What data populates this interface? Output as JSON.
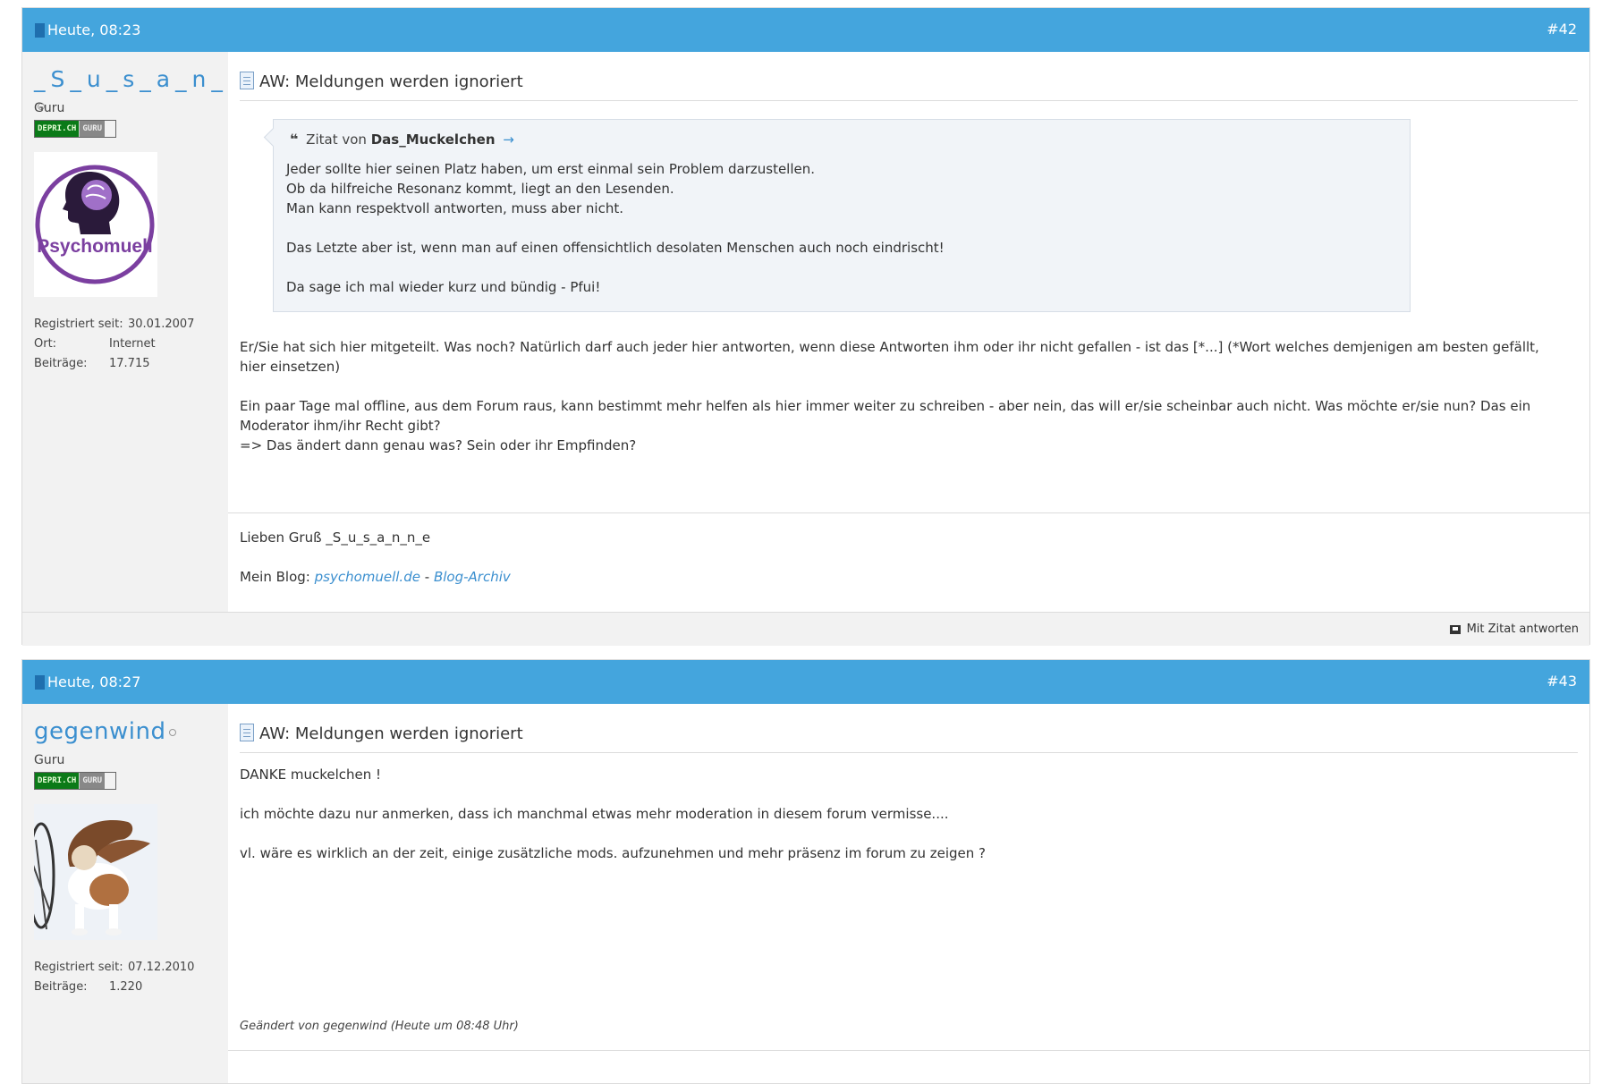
{
  "posts": [
    {
      "date": "Heute, 08:23",
      "number": "#42",
      "username": "_S_u_s_a_n_n_e_",
      "user_title": "Guru",
      "rank_badge": [
        "DEPRI.CH",
        "GURU"
      ],
      "avatar_text": "Psychomuell",
      "stats": [
        {
          "label": "Registriert seit:",
          "value": "30.01.2007"
        },
        {
          "label": "Ort:",
          "value": "Internet"
        },
        {
          "label": "Beiträge:",
          "value": "17.715"
        }
      ],
      "title": "AW: Meldungen werden ignoriert",
      "quote": {
        "prefix": "Zitat von",
        "author": "Das_Muckelchen",
        "lines": [
          "Jeder sollte hier seinen Platz haben, um erst einmal sein Problem darzustellen.",
          "Ob da hilfreiche Resonanz kommt, liegt an den Lesenden.",
          "Man kann respektvoll antworten, muss aber nicht.",
          "",
          "Das Letzte aber ist, wenn man auf einen offensichtlich desolaten Menschen auch noch eindrischt!",
          "",
          "Da sage ich mal wieder kurz und bündig - Pfui!"
        ]
      },
      "message": [
        "Er/Sie hat sich hier mitgeteilt. Was noch? Natürlich darf auch jeder hier antworten, wenn diese Antworten ihm oder ihr nicht gefallen - ist das [*...] (*Wort welches demjenigen am besten gefällt, hier einsetzen)",
        "",
        "Ein paar Tage mal offline, aus dem Forum raus, kann bestimmt mehr helfen als hier immer weiter zu schreiben - aber nein, das will er/sie scheinbar auch nicht. Was möchte er/sie nun? Das ein Moderator ihm/ihr Recht gibt?",
        "=> Das ändert dann genau was? Sein oder ihr Empfinden?"
      ],
      "signature": {
        "greeting": "Lieben Gruß _S_u_s_a_n_n_e",
        "blog_label": "Mein Blog:",
        "blog_link": "psychomuell.de",
        "separator": "-",
        "archive_link": "Blog-Archiv"
      },
      "reply_quote_label": "Mit Zitat antworten"
    },
    {
      "date": "Heute, 08:27",
      "number": "#43",
      "username": "gegenwind",
      "user_title": "Guru",
      "rank_badge": [
        "DEPRI.CH",
        "GURU"
      ],
      "stats": [
        {
          "label": "Registriert seit:",
          "value": "07.12.2010"
        },
        {
          "label": "Beiträge:",
          "value": "1.220"
        }
      ],
      "title": "AW: Meldungen werden ignoriert",
      "message": [
        "DANKE muckelchen !",
        "",
        "ich möchte dazu nur anmerken, dass ich manchmal etwas mehr moderation in diesem forum vermisse....",
        "",
        "vl. wäre es wirklich an der zeit, einige zusätzliche mods. aufzunehmen und mehr präsenz im forum zu zeigen ?"
      ],
      "edited_note": "Geändert von gegenwind (Heute um 08:48 Uhr)"
    }
  ],
  "colors": {
    "header_blue": "#44a5dd",
    "link_blue": "#3b8fcf",
    "avatar_purple": "#7b3fa0"
  }
}
